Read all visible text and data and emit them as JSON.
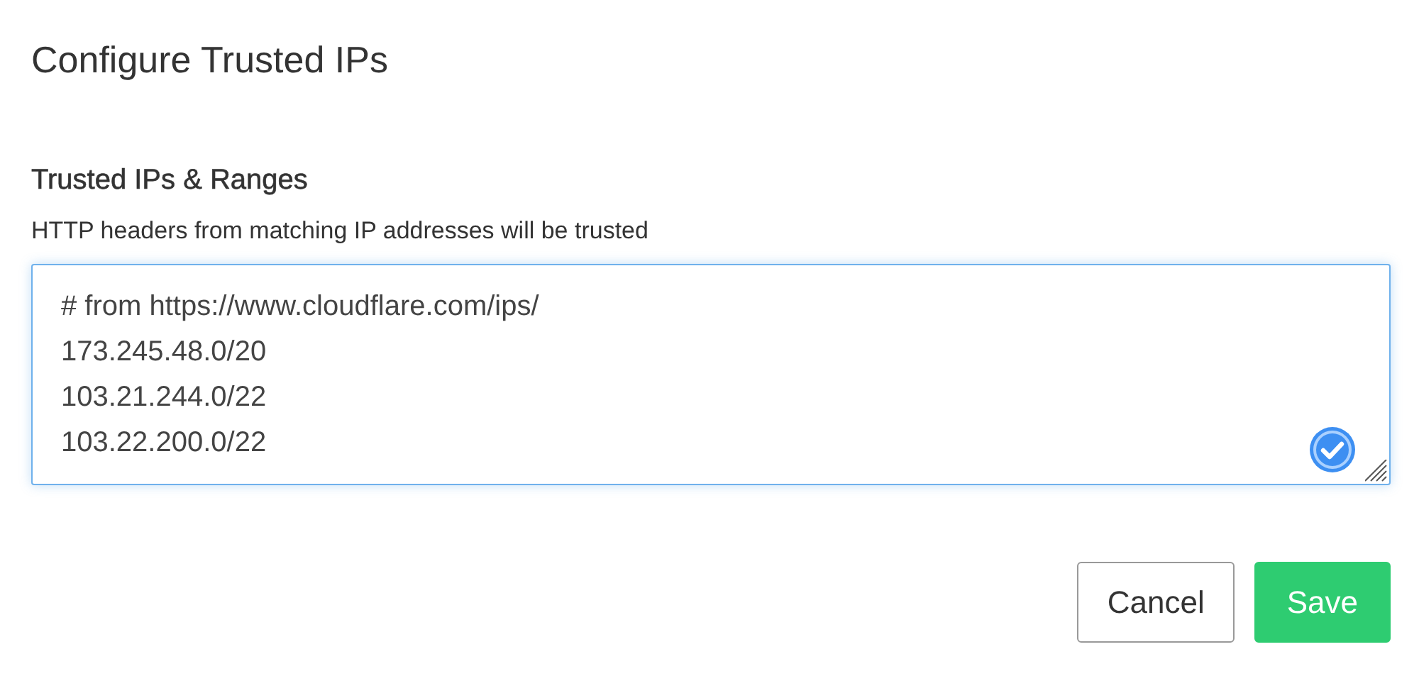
{
  "dialog": {
    "title": "Configure Trusted IPs"
  },
  "section": {
    "heading": "Trusted IPs & Ranges",
    "description": "HTTP headers from matching IP addresses will be trusted"
  },
  "ip_list": {
    "lines": [
      "# from https://www.cloudflare.com/ips/",
      "173.245.48.0/20",
      "103.21.244.0/22",
      "103.22.200.0/22"
    ],
    "focused": true
  },
  "buttons": [
    {
      "label": "Cancel",
      "kind": "secondary"
    },
    {
      "label": "Save",
      "kind": "primary"
    }
  ]
}
